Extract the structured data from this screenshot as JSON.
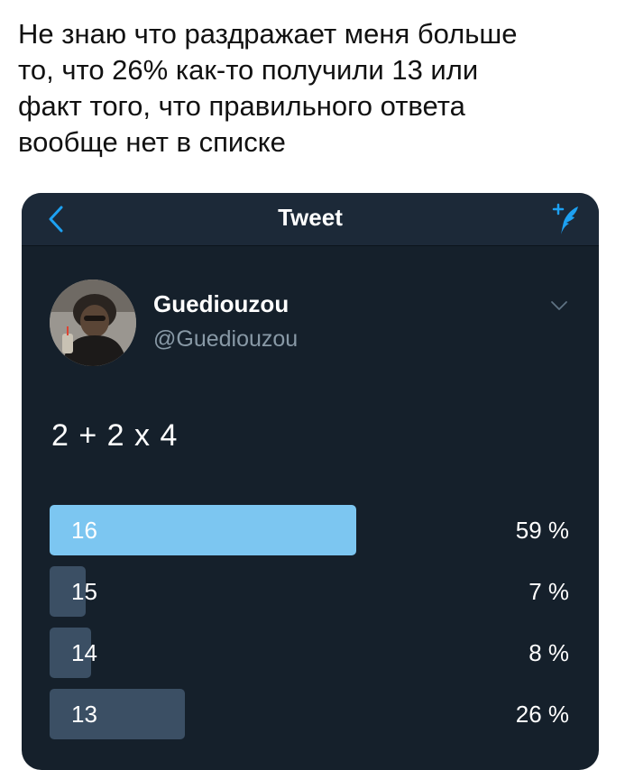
{
  "caption": {
    "lines": [
      "Не знаю что раздражает меня больше",
      "то, что 26% как-то получили 13 или",
      "факт того, что правильного ответа",
      "вообще нет в списке"
    ]
  },
  "navbar": {
    "title": "Tweet",
    "back_icon": "chevron-left-icon",
    "compose_icon": "compose-tweet-icon",
    "accent_color": "#1da1f2"
  },
  "tweet": {
    "display_name": "Guediouzou",
    "handle": "@Guediouzou",
    "text": "2 + 2 x 4"
  },
  "poll": {
    "options": [
      {
        "label": "16",
        "percent_text": "59 %",
        "percent": 59,
        "winner": true
      },
      {
        "label": "15",
        "percent_text": "7 %",
        "percent": 7,
        "winner": false
      },
      {
        "label": "14",
        "percent_text": "8 %",
        "percent": 8,
        "winner": false
      },
      {
        "label": "13",
        "percent_text": "26 %",
        "percent": 26,
        "winner": false
      }
    ]
  },
  "colors": {
    "card_background": "#15202b",
    "navbar_background": "#1c2938",
    "poll_winner": "#7cc6f1",
    "poll_other": "#3b4f64",
    "secondary_text": "#8899a6"
  }
}
